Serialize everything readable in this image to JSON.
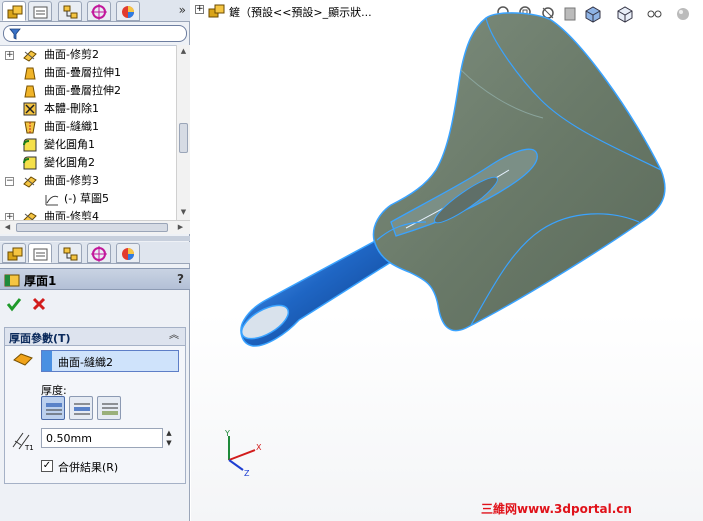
{
  "feature_tree": {
    "tabs": [
      {
        "name": "featuremanager",
        "icon": "featuremanager-tab-icon"
      },
      {
        "name": "propertymanager",
        "icon": "propertymanager-tab-icon"
      },
      {
        "name": "configurationmanager",
        "icon": "configurationmanager-tab-icon"
      },
      {
        "name": "dimxpert",
        "icon": "dimxpert-tab-icon"
      },
      {
        "name": "display",
        "icon": "displaymanager-tab-icon"
      }
    ],
    "expand_glyph": "»",
    "items": [
      {
        "label": "曲面-修剪2",
        "icon": "surface-trim-icon",
        "expandable": true,
        "indent": 0
      },
      {
        "label": "曲面-疊層拉伸1",
        "icon": "surface-loft-icon",
        "expandable": false,
        "indent": 0
      },
      {
        "label": "曲面-疊層拉伸2",
        "icon": "surface-loft-icon",
        "expandable": false,
        "indent": 0
      },
      {
        "label": "本體-刪除1",
        "icon": "body-delete-icon",
        "expandable": false,
        "indent": 0
      },
      {
        "label": "曲面-縫織1",
        "icon": "surface-knit-icon",
        "expandable": false,
        "indent": 0
      },
      {
        "label": "變化圓角1",
        "icon": "variable-fillet-icon",
        "expandable": false,
        "indent": 0
      },
      {
        "label": "變化圓角2",
        "icon": "variable-fillet-icon",
        "expandable": false,
        "indent": 0
      },
      {
        "label": "曲面-修剪3",
        "icon": "surface-trim-icon",
        "expandable": true,
        "expanded": true,
        "indent": 0
      },
      {
        "label": "(-) 草圖5",
        "icon": "sketch-icon",
        "expandable": false,
        "indent": 1
      },
      {
        "label": "曲面-修剪4",
        "icon": "surface-trim-icon",
        "expandable": true,
        "indent": 0
      }
    ]
  },
  "property_manager": {
    "title": "厚面1",
    "help": "?",
    "group_title": "厚面參數(T)",
    "face_selection": "曲面-縫織2",
    "thickness_label": "厚度:",
    "thickness_value": "0.50mm",
    "merge_label": "合併結果(R)",
    "merge_checked": true,
    "merge_mark": "✓"
  },
  "viewport": {
    "breadcrumb": "鏟（預設<<預設>_顯示狀...",
    "heads_up_tools": [
      "zoom-to-fit-icon",
      "zoom-to-area-icon",
      "previous-view-icon",
      "section-view-icon",
      "view-orientation-icon",
      "display-style-icon",
      "hide-show-icon",
      "edit-appearance-icon"
    ],
    "triad_labels": {
      "x": "X",
      "y": "Y",
      "z": "Z"
    },
    "watermark": "三維网www.3dportal.cn"
  },
  "colors": {
    "model_face": "#6f7f6e",
    "model_edge": "#3aa3ff",
    "handle": "#1f66c4",
    "watermark": "#e0121a"
  }
}
